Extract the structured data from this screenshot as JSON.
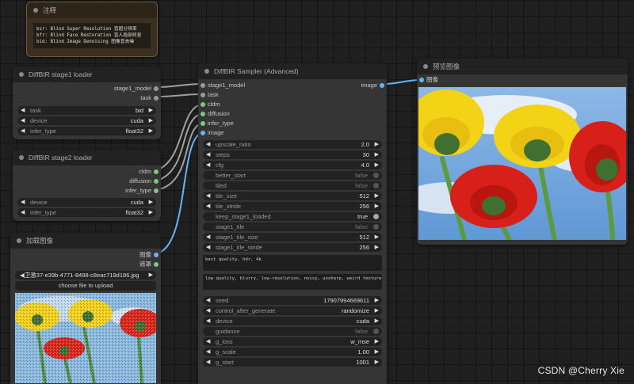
{
  "note": {
    "title": "注释",
    "lines": [
      "bsr: Blind Super Resolution 盲超分辨率",
      "bfr: Blind Face Restoration 盲人脸部修复",
      "bid: Blind Image Denoising 图像盲去噪"
    ]
  },
  "stage1": {
    "title": "DiffBIR stage1 loader",
    "outputs": [
      "stage1_model",
      "task"
    ],
    "widgets": [
      {
        "label": "task",
        "value": "bid"
      },
      {
        "label": "device",
        "value": "cuda"
      },
      {
        "label": "infer_type",
        "value": "float32"
      }
    ]
  },
  "stage2": {
    "title": "DiffBIR stage2 loader",
    "outputs": [
      "cldm",
      "diffusion",
      "infer_type"
    ],
    "widgets": [
      {
        "label": "device",
        "value": "cuda"
      },
      {
        "label": "infer_type",
        "value": "float32"
      }
    ]
  },
  "load_image": {
    "title": "加载图像",
    "outputs": [
      "图像",
      "遮罩"
    ],
    "file": "◀卫激37-e39b-4771-8498-c8eac719d186.jpg",
    "upload_label": "choose file to upload"
  },
  "sampler": {
    "title": "DiffBIR Sampler (Advanced)",
    "inputs": [
      "stage1_model",
      "task",
      "cldm",
      "diffusion",
      "infer_type",
      "image"
    ],
    "output": "image",
    "widgets": [
      {
        "label": "upscale_ratio",
        "value": "2.0",
        "kind": "num"
      },
      {
        "label": "steps",
        "value": "30",
        "kind": "num"
      },
      {
        "label": "cfg",
        "value": "4.0",
        "kind": "num"
      },
      {
        "label": "better_start",
        "value": "false",
        "kind": "toggle"
      },
      {
        "label": "tiled",
        "value": "false",
        "kind": "toggle"
      },
      {
        "label": "tile_size",
        "value": "512",
        "kind": "num"
      },
      {
        "label": "tile_stride",
        "value": "256",
        "kind": "num"
      },
      {
        "label": "keep_stage1_loaded",
        "value": "true",
        "kind": "toggle-on"
      },
      {
        "label": "stage1_tile",
        "value": "false",
        "kind": "toggle"
      },
      {
        "label": "stage1_tile_size",
        "value": "512",
        "kind": "num"
      },
      {
        "label": "stage1_tile_stride",
        "value": "256",
        "kind": "num"
      }
    ],
    "positive_prompt": "best quality, hdr, 4k",
    "negative_prompt": "low quality, blurry, low-resolution, noisy, unsharp, weird textures",
    "widgets2": [
      {
        "label": "seed",
        "value": "17907994669611",
        "kind": "num"
      },
      {
        "label": "control_after_generate",
        "value": "randomize",
        "kind": "num"
      },
      {
        "label": "device",
        "value": "cuda",
        "kind": "num"
      },
      {
        "label": "guidance",
        "value": "false",
        "kind": "toggle"
      },
      {
        "label": "g_loss",
        "value": "w_mse",
        "kind": "num"
      },
      {
        "label": "g_scale",
        "value": "1.00",
        "kind": "num"
      },
      {
        "label": "g_start",
        "value": "1001",
        "kind": "num"
      }
    ]
  },
  "preview": {
    "title": "预览图像",
    "input": "图像"
  },
  "watermark": "CSDN @Cherry Xie",
  "colors": {
    "canvas": "#1f1f1f",
    "node_bg": "#353535",
    "note_bg": "#3b3020",
    "wire_grey": "#a0a0a0",
    "wire_blue": "#64b5f6",
    "slot_green": "#7ec87e"
  }
}
